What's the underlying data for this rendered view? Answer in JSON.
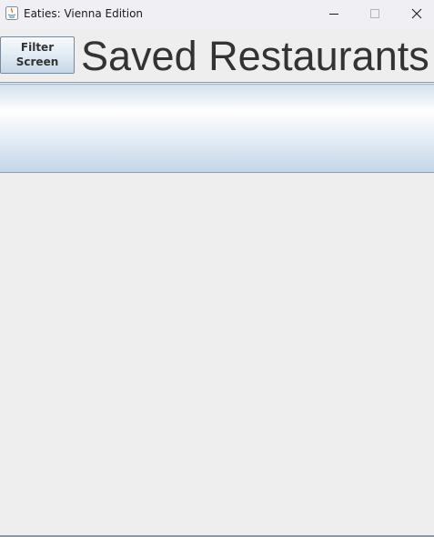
{
  "window": {
    "title": "Eaties: Vienna Edition"
  },
  "titlebar_controls": {
    "minimize_icon": "minimize-icon",
    "maximize_icon": "maximize-icon",
    "close_icon": "close-icon"
  },
  "header": {
    "filter_button": {
      "line1": "Filter",
      "line2": "Screen"
    },
    "page_title": "Saved Restaurants"
  },
  "colors": {
    "window_background": "#eeeeee",
    "title_text": "#333333",
    "panel_gradient_top": "#d3e0ec",
    "panel_gradient_bottom": "#c3d6e8"
  }
}
